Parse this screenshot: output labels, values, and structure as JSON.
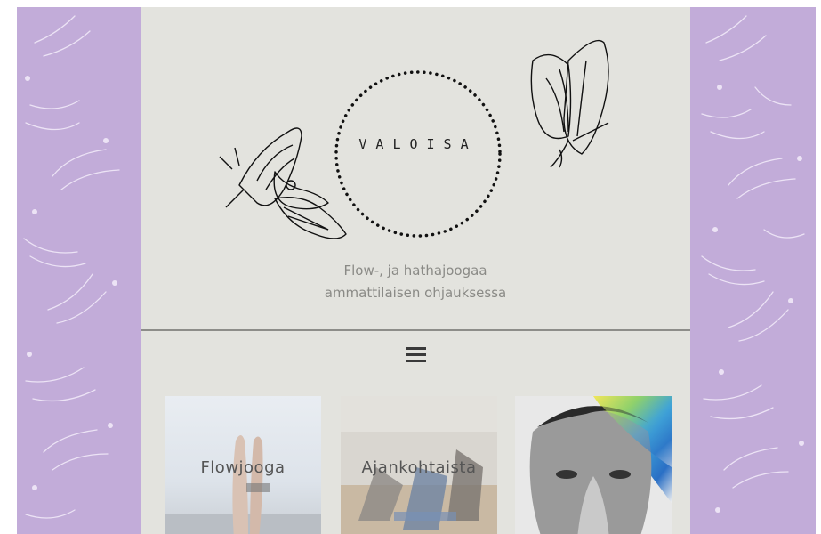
{
  "header": {
    "brand": "VALOISA",
    "tagline_line1": "Flow-, ja hathajoogaa",
    "tagline_line2": "ammattilaisen ohjauksessa"
  },
  "nav": {
    "menu_icon": "hamburger-menu-icon"
  },
  "cards": [
    {
      "label": "Flowjooga"
    },
    {
      "label": "Ajankohtaista"
    },
    {
      "label": ""
    }
  ],
  "colors": {
    "background_pattern": "#c2acd9",
    "content_panel": "#e3e3de",
    "divider": "#8d8d89",
    "tagline": "#8a8a86"
  }
}
